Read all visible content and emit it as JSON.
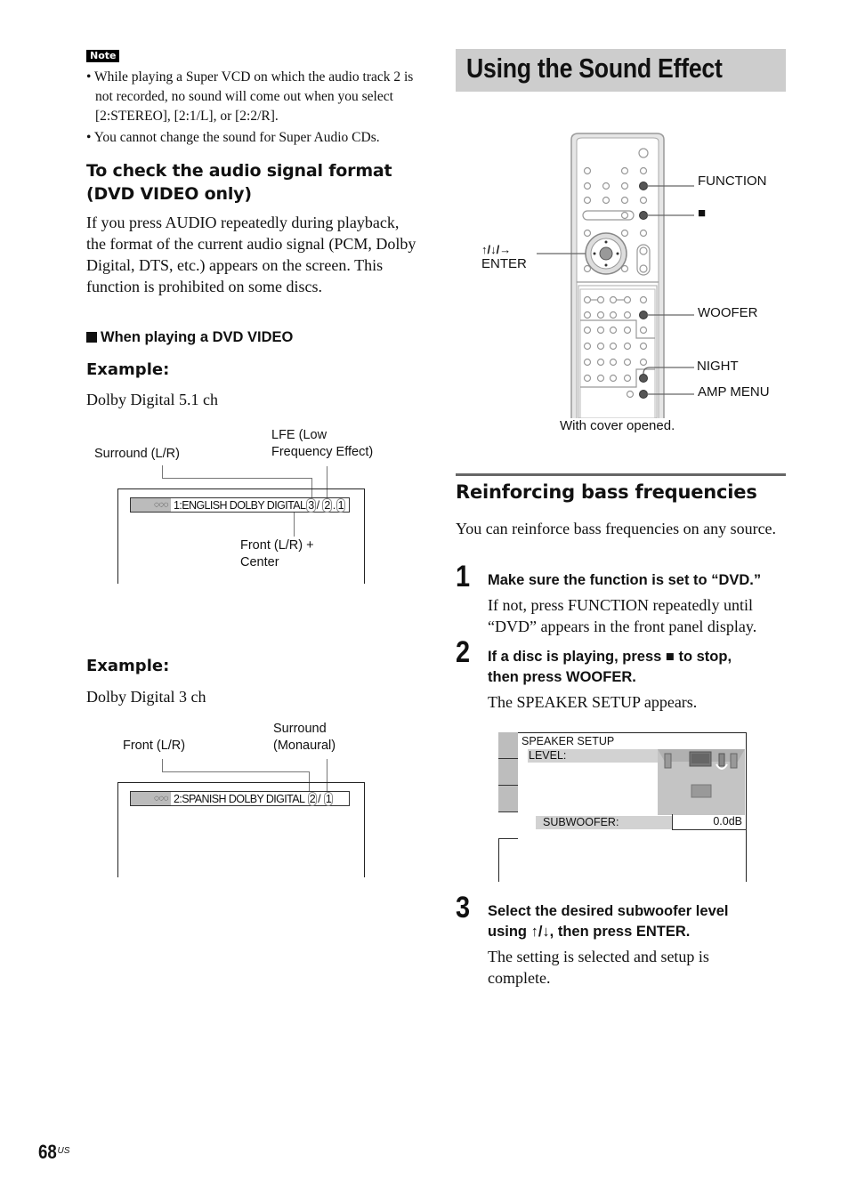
{
  "note": {
    "badge": "Note",
    "items": [
      "While playing a Super VCD on which the audio track 2 is not recorded, no sound will come out when you select [2:STEREO], [2:1/L], or [2:2/R].",
      "You cannot change the sound for Super Audio CDs."
    ]
  },
  "audio_format": {
    "heading_line1": "To check the audio signal format",
    "heading_line2": "(DVD VIDEO only)",
    "body": "If you press AUDIO repeatedly during playback, the format of the current audio signal (PCM, Dolby Digital, DTS, etc.) appears on the screen. This function is prohibited on some discs.",
    "subheading": "When playing a DVD VIDEO",
    "example1": {
      "label": "Example:",
      "caption": "Dolby Digital 5.1 ch",
      "osd_text": "1:ENGLISH DOLBY DIGITAL",
      "digits": [
        "3",
        "2",
        "1"
      ],
      "sep1": "/",
      "sep2": ".",
      "callouts": {
        "surround": "Surround (L/R)",
        "lfe_line1": "LFE (Low",
        "lfe_line2": "Frequency Effect)",
        "front_line1": "Front (L/R) +",
        "front_line2": "Center"
      }
    },
    "example2": {
      "label": "Example:",
      "caption": "Dolby Digital 3 ch",
      "osd_text": "2:SPANISH DOLBY DIGITAL",
      "digits": [
        "2",
        "1"
      ],
      "sep1": "/",
      "callouts": {
        "front": "Front (L/R)",
        "surround_line1": "Surround",
        "surround_line2": "(Monaural)"
      }
    },
    "osd_icon": "audio-disc-icon"
  },
  "sound_effect": {
    "title": "Using the Sound Effect",
    "remote": {
      "callouts": {
        "function": "FUNCTION",
        "stop": "■",
        "arrows": "↑/↓/→",
        "enter": "ENTER",
        "woofer": "WOOFER",
        "night": "NIGHT",
        "amp_menu": "AMP MENU"
      },
      "caption": "With cover opened."
    },
    "section_heading": "Reinforcing bass frequencies",
    "intro": "You can reinforce bass frequencies on any source.",
    "steps": [
      {
        "num": "1",
        "title": "Make sure the function is set to “DVD.”",
        "body": "If not, press FUNCTION repeatedly until “DVD” appears in the front panel display."
      },
      {
        "num": "2",
        "title_line1": "If a disc is playing, press ■ to stop,",
        "title_line2": "then press WOOFER.",
        "body": "The SPEAKER SETUP appears."
      },
      {
        "num": "3",
        "title_line1": "Select the desired subwoofer level",
        "title_line2": "using ↑/↓, then press ENTER.",
        "body": "The setting is selected and setup is complete."
      }
    ],
    "speaker_setup": {
      "title": "SPEAKER SETUP",
      "level_label": "LEVEL:",
      "subwoofer_label": "SUBWOOFER:",
      "subwoofer_value": "0.0dB"
    }
  },
  "footer": {
    "page_number": "68",
    "page_suffix": "US"
  }
}
